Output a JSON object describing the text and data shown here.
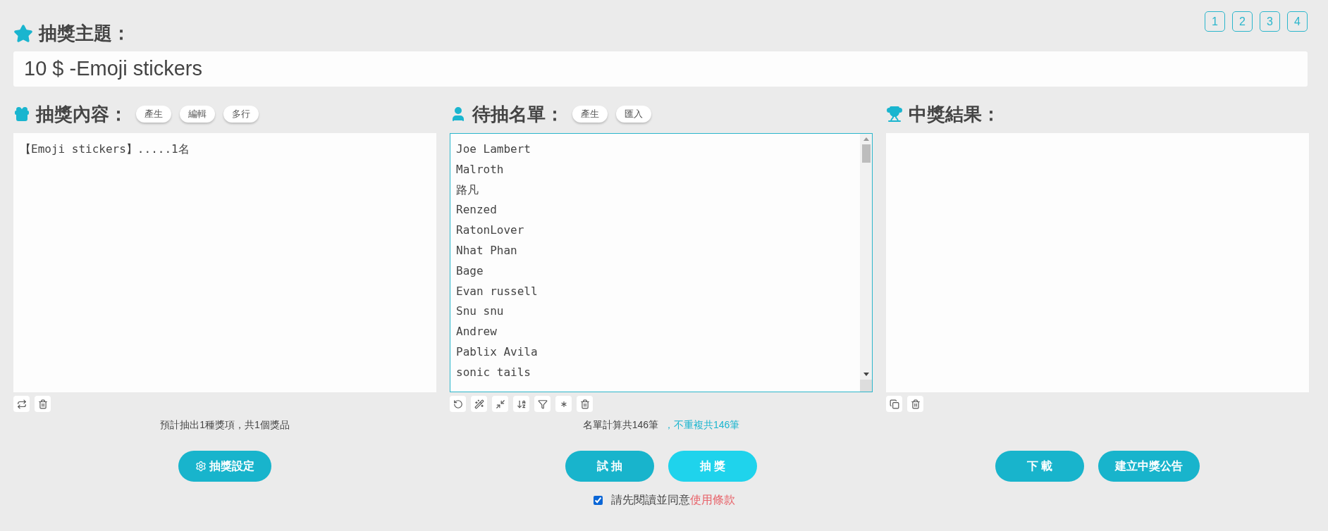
{
  "pages": [
    {
      "label": "1",
      "selected": false
    },
    {
      "label": "2",
      "selected": false
    },
    {
      "label": "3",
      "selected": false
    },
    {
      "label": "4",
      "selected": false
    }
  ],
  "topic": {
    "label": "抽獎主題：",
    "value": "10 $ -Emoji stickers"
  },
  "prizes": {
    "title": "抽獎內容：",
    "chips": [
      "產生",
      "編輯",
      "多行"
    ],
    "lines": [
      "【Emoji stickers】.....1名"
    ],
    "focused": false,
    "summary": "預計抽出1種獎項，共1個獎品",
    "buttons": [
      {
        "label": "抽獎設定",
        "hovered": false
      }
    ]
  },
  "entrants": {
    "title": "待抽名單：",
    "chips": [
      "產生",
      "匯入"
    ],
    "lines": [
      "Joe Lambert",
      "Malroth",
      "路凡",
      "Renzed",
      "RatonLover",
      "Nhat Phan",
      "Bage",
      "Evan russell",
      "Snu snu",
      "Andrew",
      "Pablix Avila",
      "sonic tails"
    ],
    "focused": true,
    "summary": "名單計算共146筆",
    "summary_note": "，不重複共146筆",
    "buttons": [
      {
        "label": "試 抽",
        "hovered": false
      },
      {
        "label": "抽 獎",
        "hovered": true
      }
    ]
  },
  "results": {
    "title": "中獎結果：",
    "focused": false,
    "buttons": [
      {
        "label": "下 載",
        "hovered": false
      },
      {
        "label": "建立中獎公告",
        "hovered": false
      }
    ]
  },
  "terms": {
    "checked": true,
    "text": "請先閱讀並同意",
    "link": "使用條款"
  }
}
